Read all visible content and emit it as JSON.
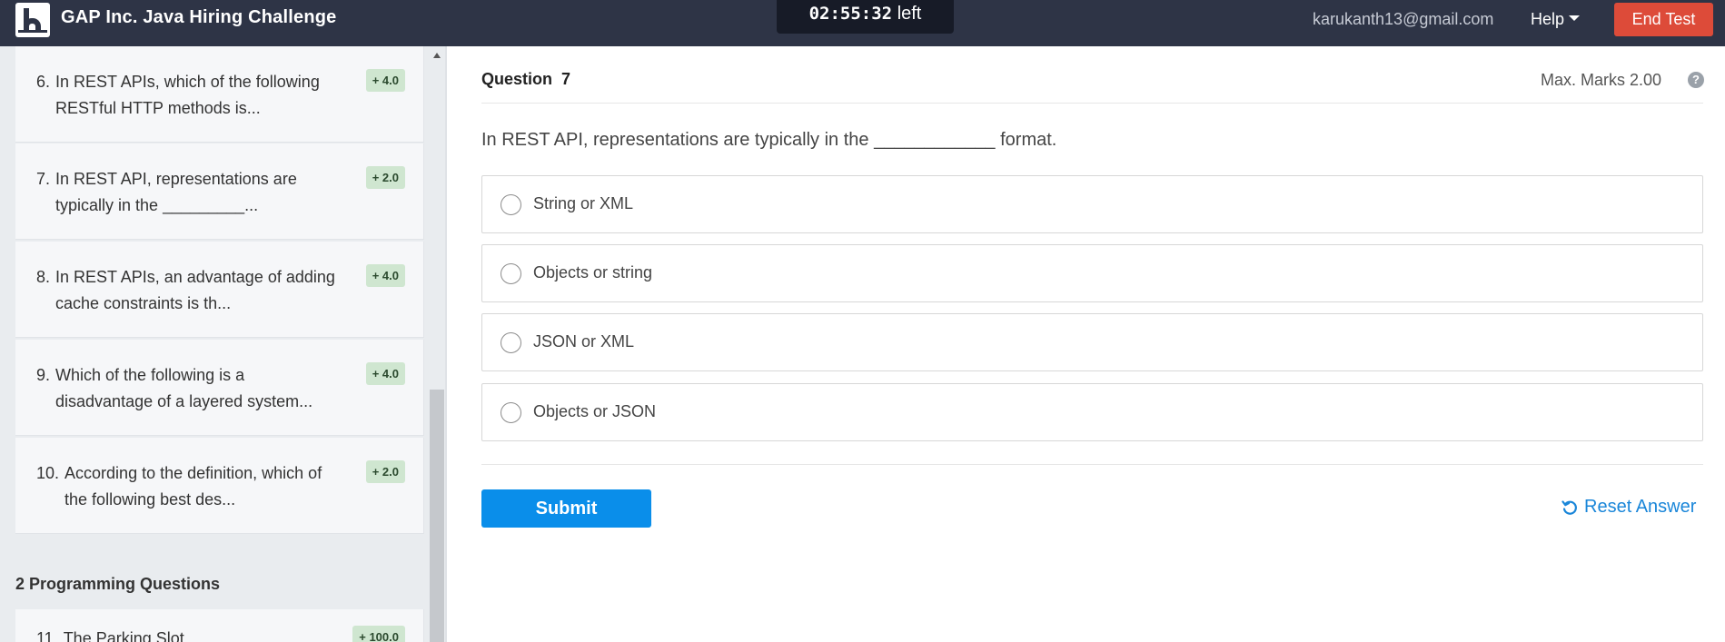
{
  "header": {
    "logo_letter": "h",
    "app_title": "GAP Inc. Java Hiring Challenge",
    "timer_value": "02:55:32",
    "timer_suffix": "left",
    "user_email": "karukanth13@gmail.com",
    "help_label": "Help",
    "end_test_label": "End Test",
    "end_test_color": "#dd4b39",
    "bar_color": "#2e3446"
  },
  "sidebar": {
    "questions": [
      {
        "num": "6.",
        "text": "In REST APIs, which of the following RESTful HTTP methods is...",
        "marks": "+ 4.0"
      },
      {
        "num": "7.",
        "text": "In REST API, representations are typically in the _________...",
        "marks": "+ 2.0"
      },
      {
        "num": "8.",
        "text": "In REST APIs, an advantage of adding cache constraints is th...",
        "marks": "+ 4.0"
      },
      {
        "num": "9.",
        "text": "Which of the following is a disadvantage of a layered system...",
        "marks": "+ 4.0"
      },
      {
        "num": "10.",
        "text": "According to the definition, which of the following best des...",
        "marks": "+ 2.0"
      }
    ],
    "section_title": "2 Programming Questions",
    "programming_questions": [
      {
        "num": "11.",
        "text": "The Parking Slot",
        "marks": "+ 100.0"
      }
    ]
  },
  "main": {
    "question_label": "Question",
    "question_number": "7",
    "max_marks": "Max. Marks 2.00",
    "help_icon_glyph": "?",
    "statement": "In REST API, representations are typically in the ____________ format.",
    "options": [
      "String or XML",
      "Objects or string",
      "JSON or XML",
      "Objects or JSON"
    ],
    "submit_label": "Submit",
    "reset_label": "Reset Answer",
    "accent_color": "#0a8eea"
  }
}
